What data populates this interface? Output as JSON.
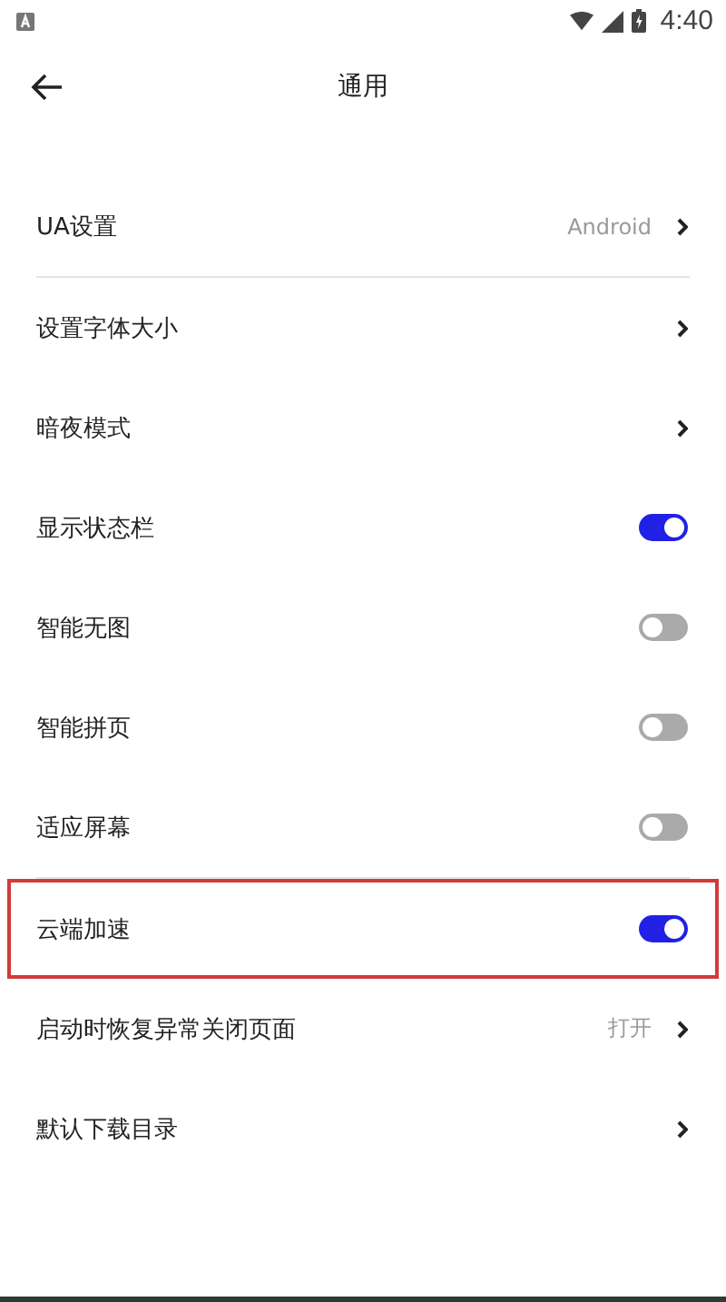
{
  "status_bar": {
    "time": "4:40"
  },
  "header": {
    "title": "通用"
  },
  "sections": [
    {
      "rows": [
        {
          "kind": "link",
          "label": "UA设置",
          "value": "Android",
          "highlighted": false
        }
      ]
    },
    {
      "rows": [
        {
          "kind": "link",
          "label": "设置字体大小",
          "highlighted": false
        },
        {
          "kind": "link",
          "label": "暗夜模式",
          "highlighted": false
        },
        {
          "kind": "toggle",
          "label": "显示状态栏",
          "on": true,
          "highlighted": false
        },
        {
          "kind": "toggle",
          "label": "智能无图",
          "on": false,
          "highlighted": false
        },
        {
          "kind": "toggle",
          "label": "智能拼页",
          "on": false,
          "highlighted": false
        },
        {
          "kind": "toggle",
          "label": "适应屏幕",
          "on": false,
          "highlighted": false
        }
      ]
    },
    {
      "rows": [
        {
          "kind": "toggle",
          "label": "云端加速",
          "on": true,
          "highlighted": true
        },
        {
          "kind": "link",
          "label": "启动时恢复异常关闭页面",
          "value": "打开",
          "highlighted": false
        },
        {
          "kind": "link",
          "label": "默认下载目录",
          "highlighted": false
        }
      ]
    }
  ]
}
